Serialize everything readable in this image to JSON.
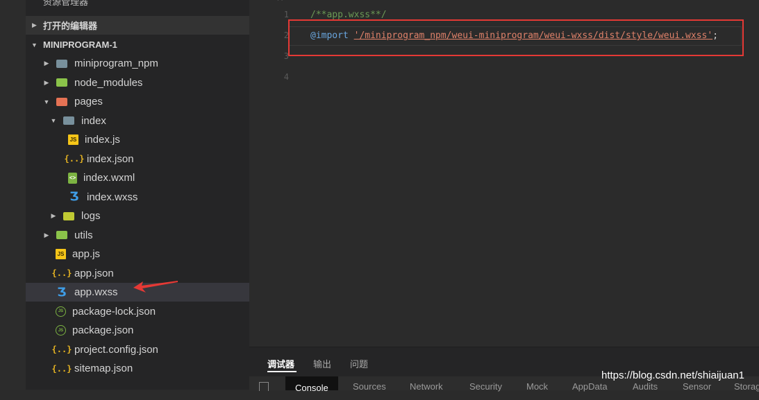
{
  "explorer": {
    "title": "资源管理器",
    "open_editors_label": "打开的编辑器",
    "project_label": "MINIPROGRAM-1",
    "items": [
      {
        "label": "miniprogram_npm",
        "icon": "folder-icon",
        "indent": 1,
        "twisty": "▶"
      },
      {
        "label": "node_modules",
        "icon": "folder-icon",
        "indent": 1,
        "twisty": "▶"
      },
      {
        "label": "pages",
        "icon": "folder-icon",
        "indent": 1,
        "twisty": "▼"
      },
      {
        "label": "index",
        "icon": "folder-icon",
        "indent": 2,
        "twisty": "▼"
      },
      {
        "label": "index.js",
        "icon": "js-icon",
        "indent": 3,
        "twisty": ""
      },
      {
        "label": "index.json",
        "icon": "json-icon",
        "indent": 3,
        "twisty": ""
      },
      {
        "label": "index.wxml",
        "icon": "wxml-icon",
        "indent": 3,
        "twisty": ""
      },
      {
        "label": "index.wxss",
        "icon": "css-icon",
        "indent": 3,
        "twisty": ""
      },
      {
        "label": "logs",
        "icon": "folder-icon",
        "indent": 2,
        "twisty": "▶"
      },
      {
        "label": "utils",
        "icon": "folder-icon",
        "indent": 1,
        "twisty": "▶"
      },
      {
        "label": "app.js",
        "icon": "js-icon",
        "indent": 1,
        "twisty": ""
      },
      {
        "label": "app.json",
        "icon": "json-icon",
        "indent": 1,
        "twisty": ""
      },
      {
        "label": "app.wxss",
        "icon": "css-icon",
        "indent": 1,
        "twisty": "",
        "selected": true
      },
      {
        "label": "package-lock.json",
        "icon": "node-icon",
        "indent": 1,
        "twisty": ""
      },
      {
        "label": "package.json",
        "icon": "node-icon",
        "indent": 1,
        "twisty": ""
      },
      {
        "label": "project.config.json",
        "icon": "json-icon",
        "indent": 1,
        "twisty": ""
      },
      {
        "label": "sitemap.json",
        "icon": "json-icon",
        "indent": 1,
        "twisty": ""
      }
    ]
  },
  "editor": {
    "line_numbers": [
      "1",
      "2",
      "3",
      "4"
    ],
    "line1": "/**app.wxss**/",
    "line2_keyword": "@import",
    "line2_string": "'/miniprogram_npm/weui-miniprogram/weui-wxss/dist/style/weui.wxss'",
    "line2_end": ";"
  },
  "panel": {
    "tabs": [
      "调试器",
      "输出",
      "问题"
    ],
    "devtools_tabs": [
      "Console",
      "Sources",
      "Network",
      "Security",
      "Mock",
      "AppData",
      "Audits",
      "Sensor",
      "Storag"
    ]
  },
  "watermark": "https://blog.csdn.net/shiaijuan1",
  "colors": {
    "highlight_box": "#e53935",
    "arrow": "#e53935",
    "selected_row": "#37373d"
  }
}
